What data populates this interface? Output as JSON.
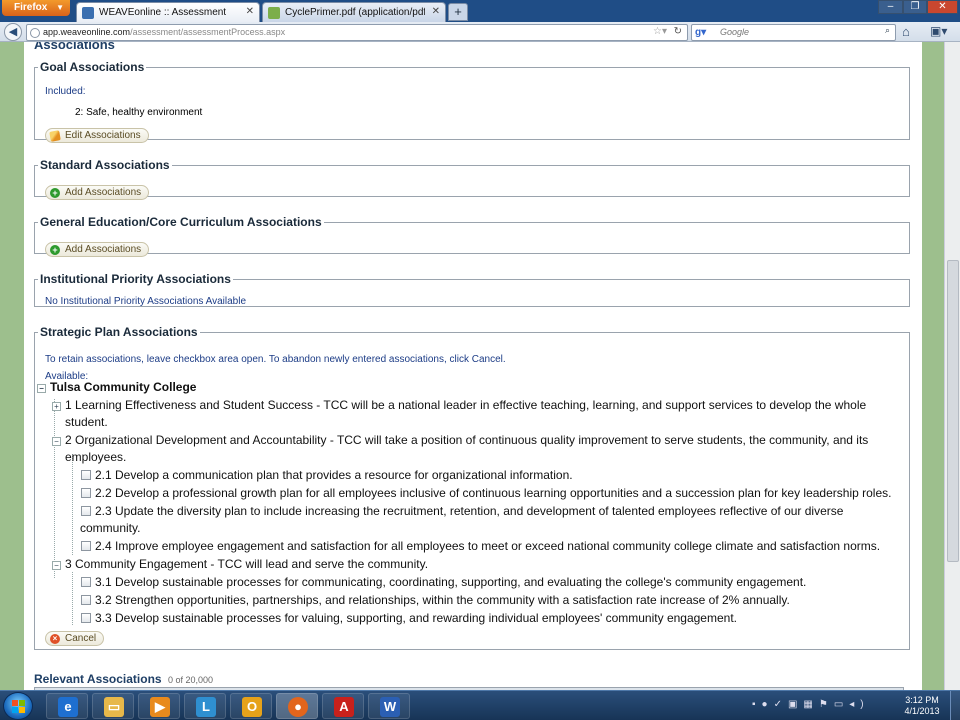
{
  "browser": {
    "menu_label": "Firefox",
    "tabs": [
      {
        "label": "WEAVEonline :: Assessment",
        "active": true
      },
      {
        "label": "CyclePrimer.pdf (application/pdf Obj...",
        "active": false
      }
    ],
    "new_tab": "+",
    "url_host": "app.weaveonline.com",
    "url_path": "/assessment/assessmentProcess.aspx",
    "search_placeholder": "Google"
  },
  "page": {
    "section_title": "Associations",
    "goal": {
      "legend": "Goal Associations",
      "included_label": "Included:",
      "item": "2: Safe, healthy environment",
      "button": "Edit Associations"
    },
    "standard": {
      "legend": "Standard Associations",
      "button": "Add Associations"
    },
    "gened": {
      "legend": "General Education/Core Curriculum Associations",
      "button": "Add Associations"
    },
    "institutional": {
      "legend": "Institutional Priority Associations",
      "text": "No Institutional Priority Associations Available"
    },
    "strategic": {
      "legend": "Strategic Plan Associations",
      "note": "To retain associations, leave checkbox area open. To abandon newly entered associations, click Cancel.",
      "available_label": "Available:",
      "root": "Tulsa Community College",
      "node1": "1 Learning Effectiveness and Student Success - TCC will be a national leader in effective teaching, learning, and support services to develop the whole",
      "node1_cont": "student.",
      "node2": "2 Organizational Development and Accountability - TCC will take a position of continuous quality improvement to serve students, the community, and its",
      "node2_cont": "employees.",
      "node2_children": [
        "2.1 Develop a communication plan that provides a resource for organizational information.",
        "2.2 Develop a professional growth plan for all employees inclusive of continuous learning opportunities and a succession plan for key leadership roles.",
        "2.3 Update the diversity plan to include increasing the recruitment, retention, and development of talented employees reflective of our diverse",
        "2.4 Improve employee engagement and satisfaction for all employees to meet or exceed national community college climate and satisfaction norms."
      ],
      "node2_3_cont": "community.",
      "node3": "3 Community Engagement - TCC will lead and serve the community.",
      "node3_children": [
        "3.1 Develop sustainable processes for communicating, coordinating, supporting, and evaluating the college's community engagement.",
        "3.2 Strengthen opportunities, partnerships, and relationships, within the community with a satisfaction rate increase of 2% annually.",
        "3.3 Develop sustainable processes for valuing, supporting, and rewarding individual employees' community engagement."
      ],
      "cancel": "Cancel"
    },
    "relevant": {
      "title": "Relevant Associations",
      "count": "0 of 20,000"
    }
  },
  "taskbar": {
    "time": "3:12 PM",
    "date": "4/1/2013"
  },
  "colors": {
    "accent": "#1c3c86",
    "tabbar": "#1f4d86",
    "gutter": "#9dbf8d"
  }
}
